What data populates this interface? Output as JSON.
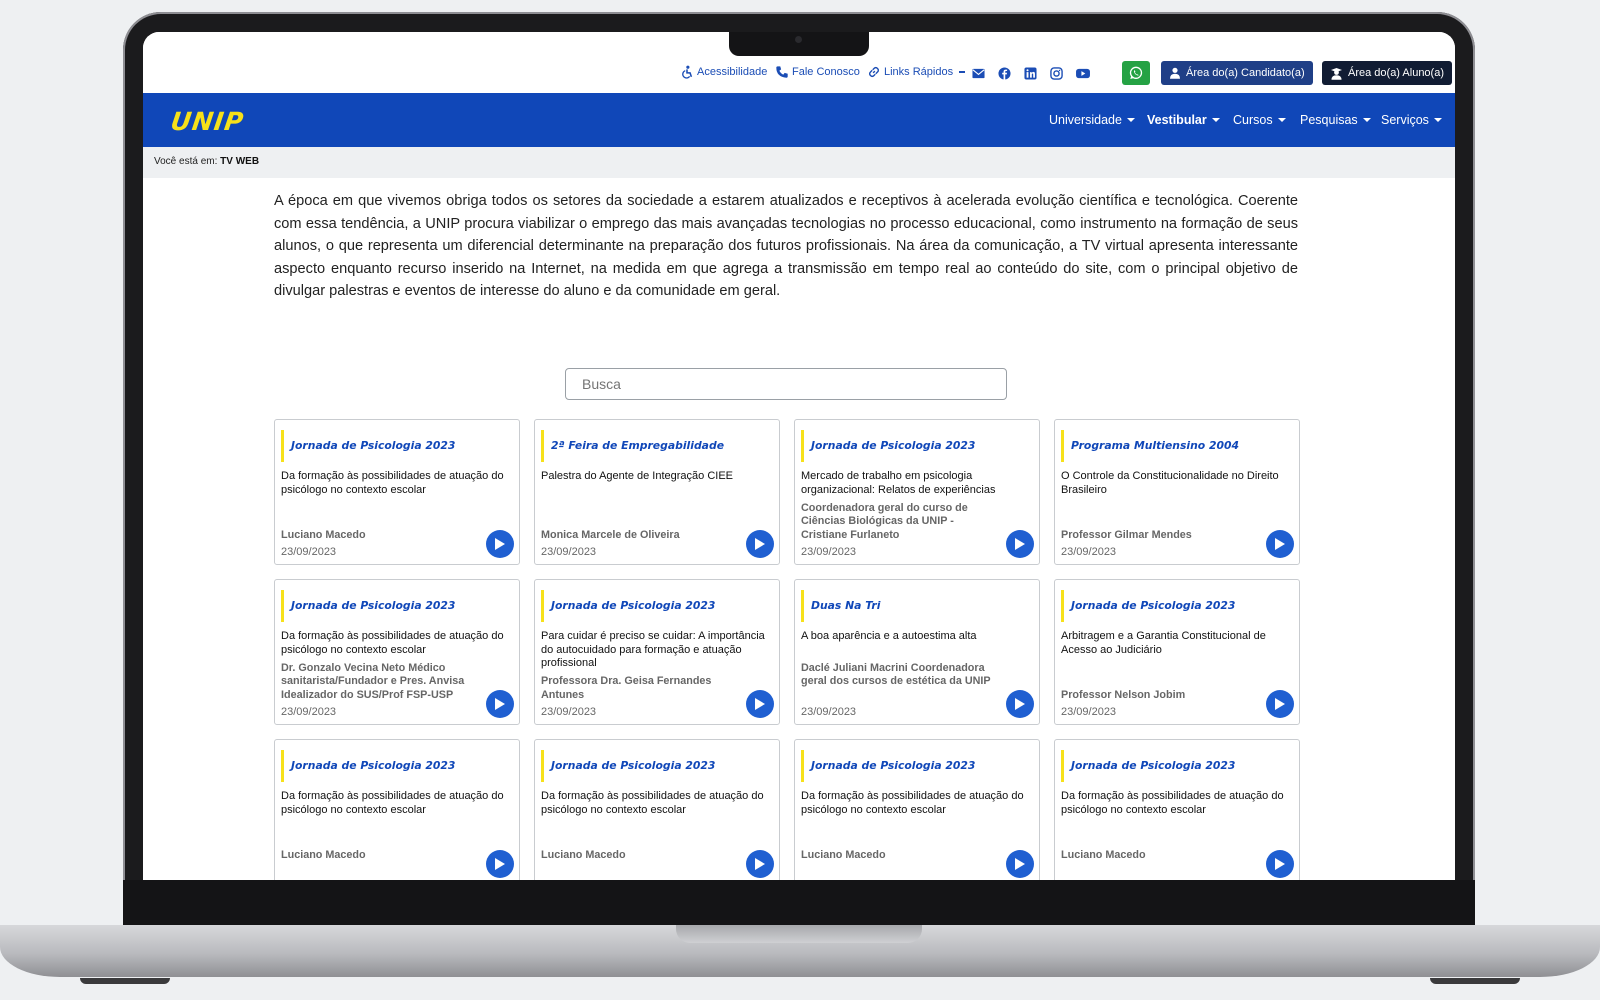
{
  "utility": {
    "accessibility": "Acessibilidade",
    "contact": "Fale Conosco",
    "quick_links": "Links Rápidos",
    "candidate_area": "Área do(a) Candidato(a)",
    "student_area": "Área do(a) Aluno(a)"
  },
  "nav": {
    "logo": "UNIP",
    "items": [
      {
        "label": "Universidade"
      },
      {
        "label": "Vestibular"
      },
      {
        "label": "Cursos"
      },
      {
        "label": "Pesquisas"
      },
      {
        "label": "Serviços"
      }
    ]
  },
  "breadcrumb": {
    "prefix": "Você está em:",
    "current": "TV WEB"
  },
  "intro": "A época em que vivemos obriga todos os setores da sociedade a estarem atualizados e receptivos à acelerada evolução científica e tecnológica. Coerente com essa tendência, a UNIP procura viabilizar o emprego das mais avançadas tecnologias no processo educacional, como instrumento na formação de seus alunos, o que representa um diferencial determinante na preparação dos futuros profissionais. Na área da comunicação, a TV virtual apresenta interessante aspecto enquanto recurso inserido na Internet, na medida em que agrega a transmissão em tempo real ao conteúdo do site, com o principal objetivo de divulgar palestras e eventos de interesse do aluno e da comunidade em geral.",
  "search": {
    "placeholder": "Busca"
  },
  "cards": [
    {
      "tag": "Jornada de Psicologia 2023",
      "title": "Da formação às possibilidades de atuação do psicólogo no contexto escolar",
      "author": "Luciano Macedo",
      "date": "23/09/2023"
    },
    {
      "tag": "2ª Feira de Empregabilidade",
      "title": "Palestra do Agente de Integração CIEE",
      "author": "Monica Marcele de Oliveira",
      "date": "23/09/2023"
    },
    {
      "tag": "Jornada de Psicologia 2023",
      "title": "Mercado de trabalho em psicologia organizacional: Relatos de experiências",
      "author": "Coordenadora geral do curso de Ciências Biológicas da UNIP - Cristiane Furlaneto",
      "date": "23/09/2023"
    },
    {
      "tag": "Programa Multiensino 2004",
      "title": "O Controle da Constitucionalidade no Direito Brasileiro",
      "author": "Professor Gilmar Mendes",
      "date": "23/09/2023"
    },
    {
      "tag": "Jornada de Psicologia 2023",
      "title": "Da formação às possibilidades de atuação do psicólogo no contexto escolar",
      "author": "Dr. Gonzalo Vecina Neto Médico sanitarista/Fundador e Pres. Anvisa Idealizador do SUS/Prof FSP-USP",
      "date": "23/09/2023"
    },
    {
      "tag": "Jornada de Psicologia 2023",
      "title": "Para cuidar é preciso se cuidar: A importância do autocuidado para formação e atuação profissional",
      "author": "Professora Dra. Geisa Fernandes Antunes",
      "date": "23/09/2023"
    },
    {
      "tag": "Duas Na Tri",
      "title": "A boa aparência e a autoestima alta",
      "author": "Daclé Juliani Macrini Coordenadora geral  dos cursos  de estética da UNIP",
      "date": "23/09/2023"
    },
    {
      "tag": "Jornada de Psicologia 2023",
      "title": "Arbitragem e a Garantia Constitucional de Acesso ao Judiciário",
      "author": "Professor Nelson Jobim",
      "date": "23/09/2023"
    },
    {
      "tag": "Jornada de Psicologia 2023",
      "title": "Da formação às possibilidades de atuação do psicólogo no contexto escolar",
      "author": "Luciano Macedo",
      "date": ""
    },
    {
      "tag": "Jornada de Psicologia 2023",
      "title": "Da formação às possibilidades de atuação do psicólogo no contexto escolar",
      "author": "Luciano Macedo",
      "date": ""
    },
    {
      "tag": "Jornada de Psicologia 2023",
      "title": "Da formação às possibilidades de atuação do psicólogo no contexto escolar",
      "author": "Luciano Macedo",
      "date": ""
    },
    {
      "tag": "Jornada de Psicologia 2023",
      "title": "Da formação às possibilidades de atuação do psicólogo no contexto escolar",
      "author": "Luciano Macedo",
      "date": ""
    }
  ],
  "colors": {
    "nav_blue": "#1047b8",
    "logo_yellow": "#f7e11a",
    "whatsapp_green": "#25a244",
    "play_blue": "#1f5fd1"
  },
  "icons": [
    "accessibility-icon",
    "phone-icon",
    "link-icon",
    "email-icon",
    "facebook-icon",
    "linkedin-icon",
    "instagram-icon",
    "youtube-icon",
    "whatsapp-icon",
    "user-icon",
    "graduate-icon",
    "play-icon"
  ]
}
